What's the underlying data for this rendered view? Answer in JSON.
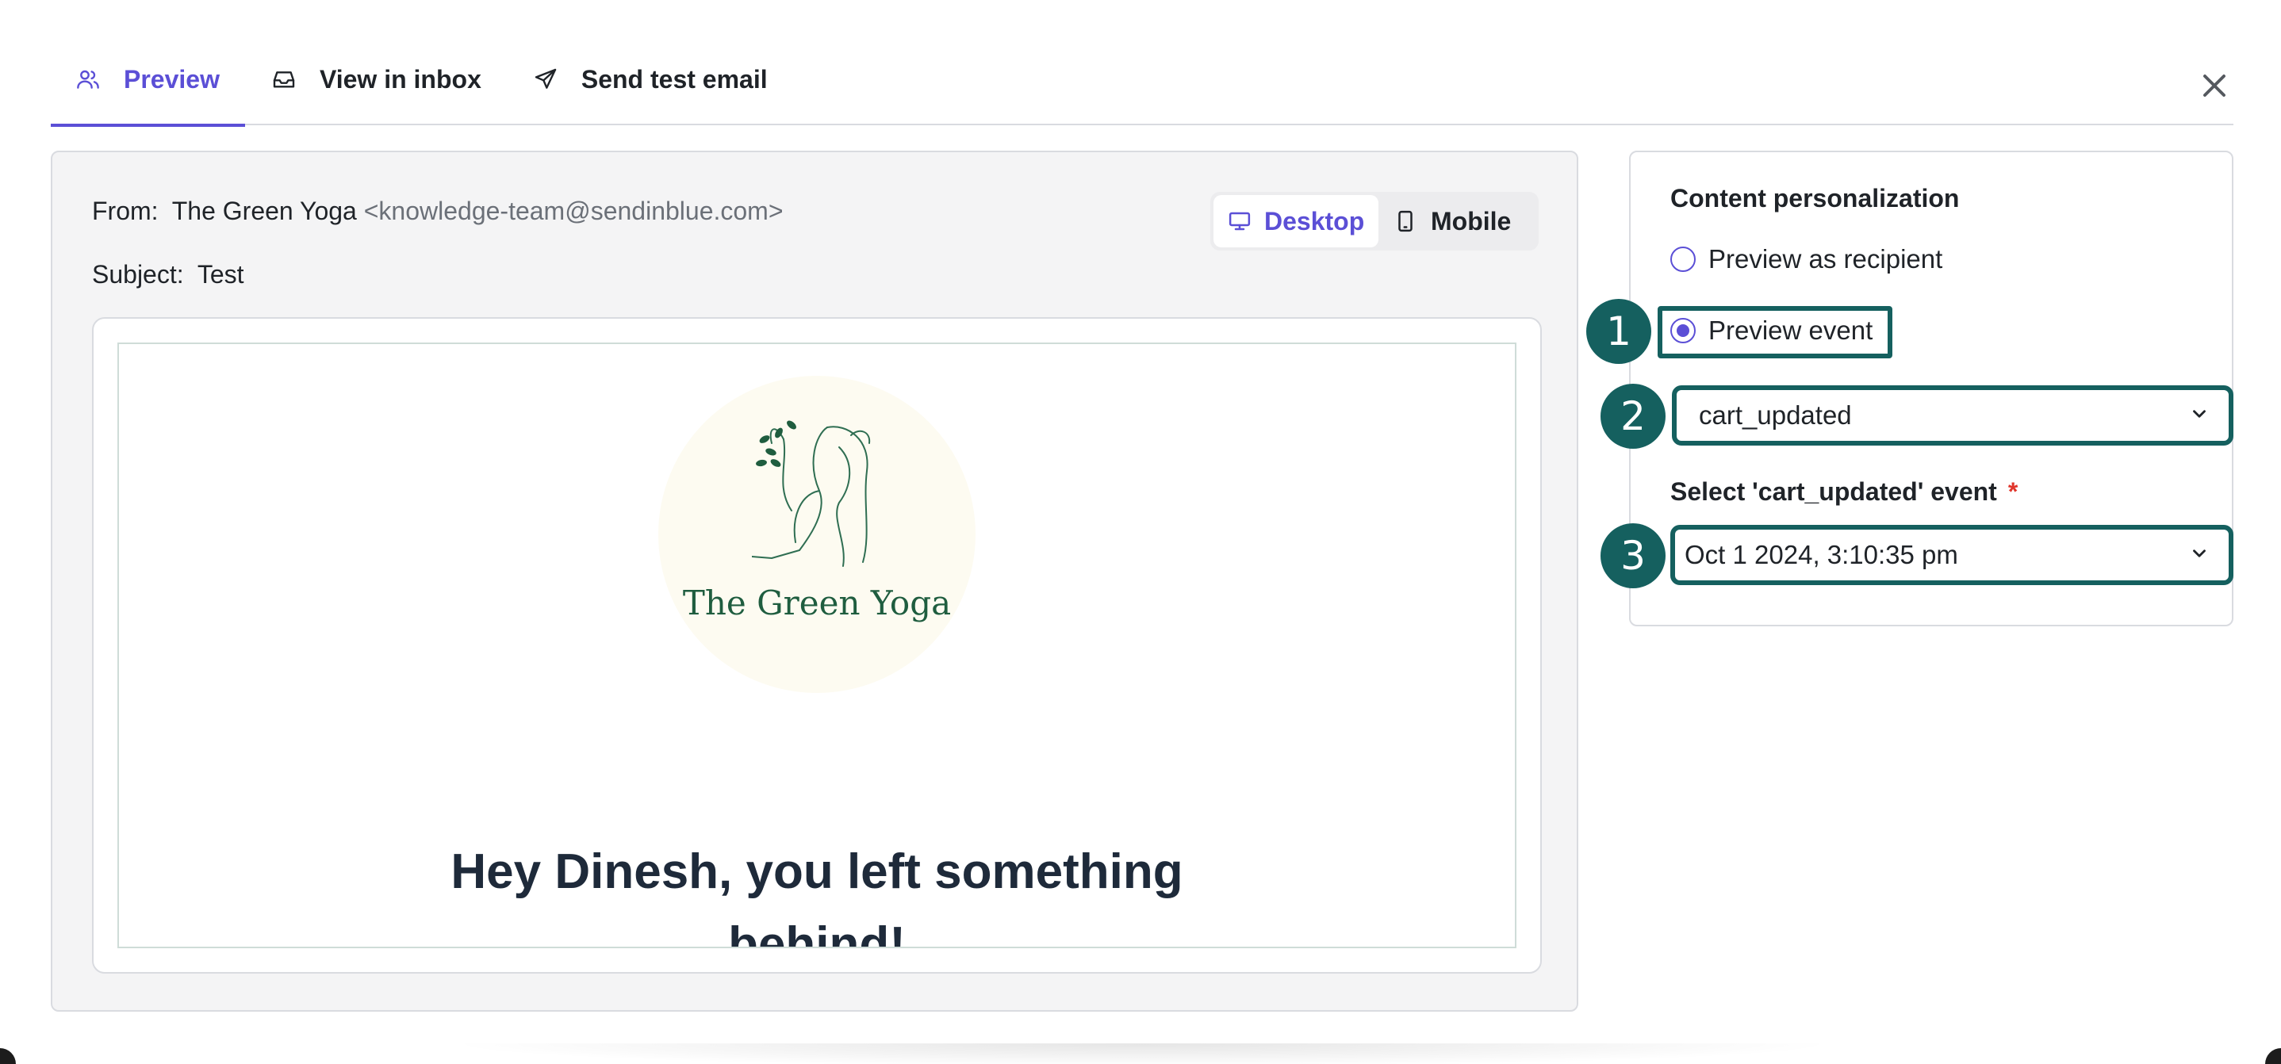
{
  "tabs": [
    {
      "label": "Preview",
      "icon": "users-icon",
      "active": true
    },
    {
      "label": "View in inbox",
      "icon": "inbox-icon",
      "active": false
    },
    {
      "label": "Send test email",
      "icon": "send-icon",
      "active": false
    }
  ],
  "close_icon": "close-icon",
  "preview": {
    "from_label": "From:",
    "from_name": "The Green Yoga",
    "from_email": "<knowledge-team@sendinblue.com>",
    "subject_label": "Subject:",
    "subject_value": "Test",
    "device_toggle": {
      "desktop_label": "Desktop",
      "mobile_label": "Mobile",
      "selected": "Desktop"
    },
    "email": {
      "logo_text": "The Green Yoga",
      "heading_line1": "Hey Dinesh, you left something",
      "heading_line2": "behind!"
    }
  },
  "personalization": {
    "title": "Content personalization",
    "options": [
      {
        "label": "Preview as recipient",
        "selected": false
      },
      {
        "label": "Preview event",
        "selected": true
      }
    ],
    "event_select_value": "cart_updated",
    "event_date_label": "Select 'cart_updated' event",
    "required_mark": "*",
    "event_date_value": "Oct 1 2024, 3:10:35 pm"
  },
  "annotations": {
    "step1": "1",
    "step2": "2",
    "step3": "3"
  },
  "colors": {
    "accent": "#5b4fd6",
    "highlight": "#15605f",
    "required": "#e0352b",
    "logo_green": "#1f5d3f"
  }
}
